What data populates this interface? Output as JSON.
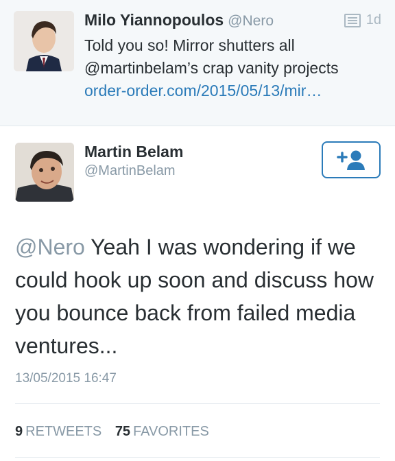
{
  "reply": {
    "name": "Milo Yiannopoulos",
    "handle": "@Nero",
    "time": "1d",
    "text_line1": "Told you so! Mirror shutters all",
    "text_line2": "@martinbelam’s crap vanity projects",
    "link": "order-order.com/2015/05/13/mir…"
  },
  "tweet": {
    "name": "Martin Belam",
    "handle": "@MartinBelam",
    "mention": "@Nero",
    "text": " Yeah I was wondering if we could hook up soon and discuss how you bounce back from failed media ventures...",
    "timestamp": "13/05/2015 16:47",
    "retweets_count": "9",
    "retweets_label": "RETWEETS",
    "favorites_count": "75",
    "favorites_label": "FAVORITES"
  },
  "colors": {
    "accent": "#2b7bb9",
    "muted": "#8899a6",
    "text": "#292f33"
  }
}
